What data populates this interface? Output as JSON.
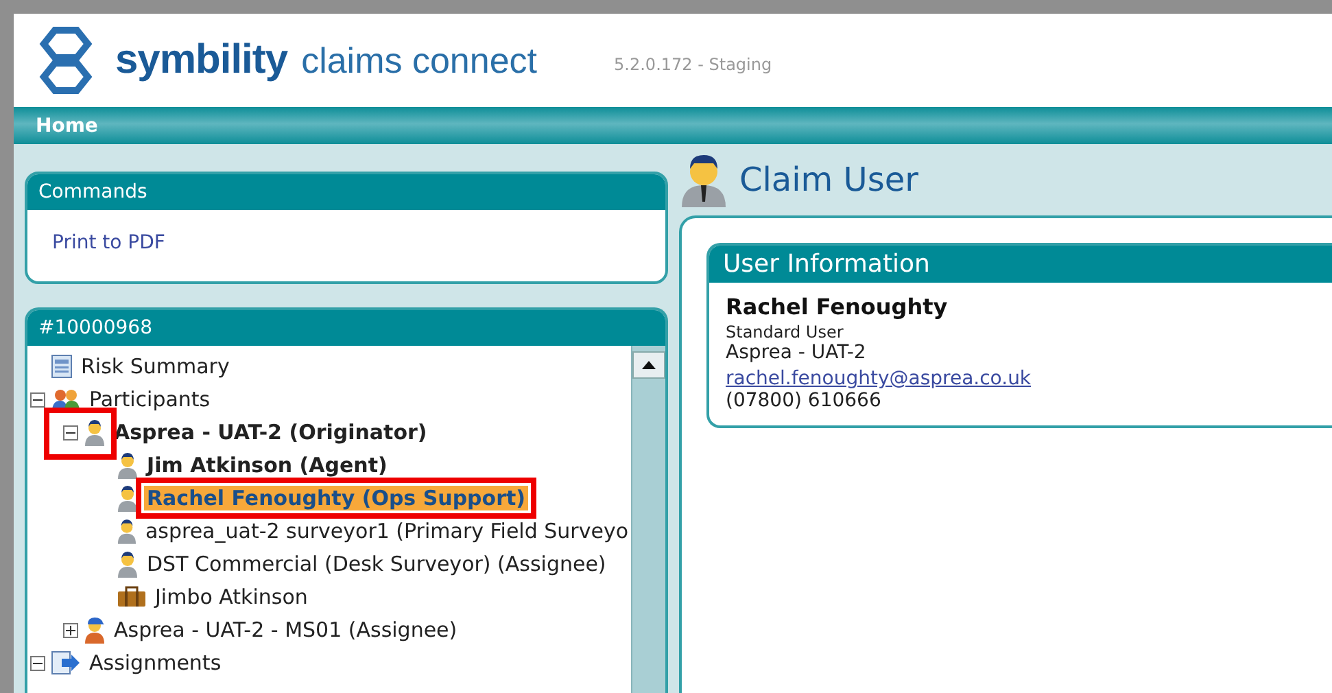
{
  "header": {
    "brand": "symbility",
    "product": "claims connect",
    "version": "5.2.0.172 - Staging"
  },
  "nav": {
    "items": [
      {
        "label": "Home",
        "selected": true
      }
    ]
  },
  "commands": {
    "title": "Commands",
    "items": [
      "Print to PDF"
    ]
  },
  "claim_tree": {
    "title": "#10000968",
    "items": [
      {
        "label": "Risk Summary",
        "kind": "document",
        "bold": false,
        "selected": false,
        "highlighted": false
      },
      {
        "label": "Participants",
        "kind": "group",
        "bold": false,
        "selected": false,
        "highlighted": false,
        "expanded": true,
        "toggle_highlighted": false,
        "children": [
          {
            "label": "Asprea - UAT-2 (Originator)",
            "kind": "person",
            "bold": true,
            "selected": false,
            "highlighted": false,
            "expanded": true,
            "toggle_highlighted": true,
            "children": [
              {
                "label": "Jim Atkinson (Agent)",
                "kind": "person",
                "bold": true,
                "selected": false,
                "highlighted": false
              },
              {
                "label": "Rachel Fenoughty (Ops Support)",
                "kind": "person",
                "bold": true,
                "selected": true,
                "highlighted": true
              },
              {
                "label": "asprea_uat-2 surveyor1 (Primary Field Surveyo",
                "kind": "person",
                "bold": false,
                "selected": false,
                "highlighted": false
              },
              {
                "label": "DST Commercial (Desk Surveyor) (Assignee)",
                "kind": "person",
                "bold": false,
                "selected": false,
                "highlighted": false
              },
              {
                "label": "Jimbo Atkinson",
                "kind": "briefcase",
                "bold": false,
                "selected": false,
                "highlighted": false
              }
            ]
          },
          {
            "label": "Asprea - UAT-2 - MS01 (Assignee)",
            "kind": "worker",
            "bold": false,
            "selected": false,
            "highlighted": false,
            "expanded": false,
            "toggle_highlighted": false
          }
        ]
      },
      {
        "label": "Assignments",
        "kind": "assignment",
        "bold": false,
        "selected": false,
        "highlighted": false,
        "expanded": true,
        "toggle_highlighted": false
      }
    ]
  },
  "page": {
    "title": "Claim User"
  },
  "user_info": {
    "title": "User Information",
    "name": "Rachel Fenoughty",
    "role": "Standard User",
    "company": "Asprea - UAT-2",
    "email": "rachel.fenoughty@asprea.co.uk",
    "phone": "(07800) 610666"
  }
}
